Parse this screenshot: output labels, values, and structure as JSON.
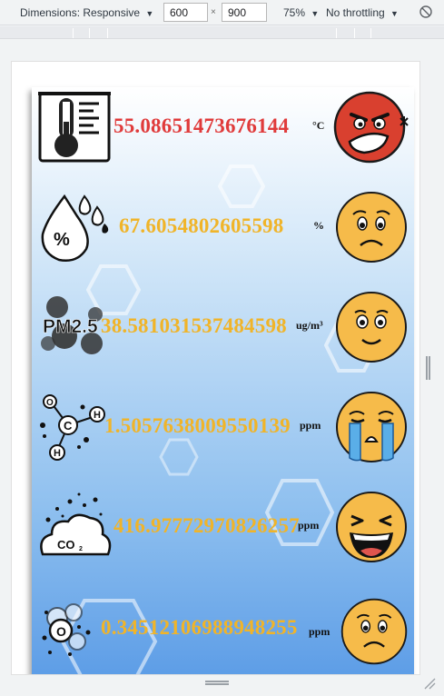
{
  "toolbar": {
    "dimensions_label": "Dimensions: Responsive",
    "width": "600",
    "height": "900",
    "times": "×",
    "zoom": "75%",
    "throttling": "No throttling",
    "caret": "▼"
  },
  "readings": [
    {
      "sensor": "thermometer-icon",
      "value": "55.08651473676144",
      "unit": "°C",
      "value_color": "#e03b3b",
      "mood": "angry-face"
    },
    {
      "sensor": "humidity-drop-icon",
      "value": "67.6054802605598",
      "unit": "%",
      "value_color": "#f0b429",
      "mood": "worried-face"
    },
    {
      "sensor": "pm25-icon",
      "value": "38.581031537484598",
      "unit": "ug/m³",
      "value_color": "#f0b429",
      "mood": "smiling-face"
    },
    {
      "sensor": "formaldehyde-molecule-icon",
      "value": "1.5057638009550139",
      "unit": "ppm",
      "value_color": "#f0b429",
      "mood": "crying-face"
    },
    {
      "sensor": "co2-cloud-icon",
      "value": "416.97772970826257",
      "unit": "ppm",
      "value_color": "#f0b429",
      "mood": "laughing-face"
    },
    {
      "sensor": "ozone-icon",
      "value": "0.34512106988948255",
      "unit": "ppm",
      "value_color": "#f0b429",
      "mood": "worried-face"
    }
  ]
}
